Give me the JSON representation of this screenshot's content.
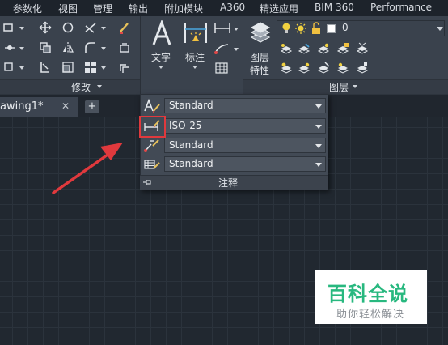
{
  "menubar": {
    "items": [
      "参数化",
      "视图",
      "管理",
      "输出",
      "附加模块",
      "A360",
      "精选应用",
      "BIM 360",
      "Performance"
    ]
  },
  "ribbon": {
    "modify_panel_title": "修改",
    "text_label": "文字",
    "dimension_label": "标注",
    "layer_properties_label_line1": "图层",
    "layer_properties_label_line2": "特性",
    "layer_panel_title": "图层",
    "current_layer": "0"
  },
  "file_tabs": {
    "active_tab": "awing1*",
    "close_glyph": "✕",
    "new_tab_glyph": "+"
  },
  "annotation_flyout": {
    "title": "注释",
    "text_style": "Standard",
    "dimension_style": "ISO-25",
    "multileader_style": "Standard",
    "table_style": "Standard"
  },
  "watermark": {
    "title": "百科全说",
    "subtitle": "助你轻松解决"
  },
  "colors": {
    "highlight": "#e0393d",
    "arrow": "#e0393d",
    "watermark_green": "#28b87f",
    "canvas_bg": "#212830",
    "ribbon_bg": "#3a424d"
  },
  "icons": [
    "lightbulb-icon",
    "sun-icon",
    "lock-icon",
    "color-swatch-icon",
    "text-style-icon",
    "dimension-style-icon",
    "multileader-style-icon",
    "table-style-icon",
    "pin-icon",
    "arrow-annotation"
  ]
}
